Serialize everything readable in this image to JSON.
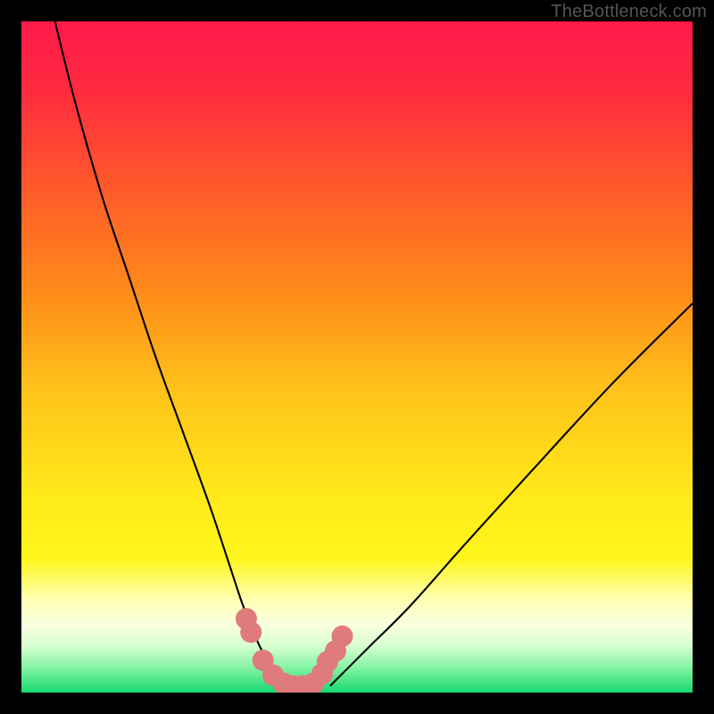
{
  "watermark": "TheBottleneck.com",
  "chart_data": {
    "type": "line",
    "title": "",
    "xlabel": "",
    "ylabel": "",
    "xlim": [
      0,
      100
    ],
    "ylim": [
      0,
      100
    ],
    "background_gradient": {
      "stops": [
        {
          "offset": 0.0,
          "color": "#ff1a4b"
        },
        {
          "offset": 0.1,
          "color": "#ff2a3f"
        },
        {
          "offset": 0.25,
          "color": "#ff5a2a"
        },
        {
          "offset": 0.4,
          "color": "#ff8a1a"
        },
        {
          "offset": 0.55,
          "color": "#ffc21a"
        },
        {
          "offset": 0.7,
          "color": "#ffe81a"
        },
        {
          "offset": 0.8,
          "color": "#fff61a"
        },
        {
          "offset": 0.86,
          "color": "#ffffb0"
        },
        {
          "offset": 0.9,
          "color": "#faffe0"
        },
        {
          "offset": 0.93,
          "color": "#d8ffd0"
        },
        {
          "offset": 0.96,
          "color": "#8cf5a8"
        },
        {
          "offset": 1.0,
          "color": "#17d86f"
        }
      ]
    },
    "series": [
      {
        "name": "curve-left",
        "x": [
          5,
          8,
          12,
          16,
          20,
          24,
          28,
          31,
          33,
          35,
          36.5,
          38,
          39
        ],
        "y": [
          100,
          88,
          74,
          62,
          50,
          39,
          28,
          19,
          13,
          8,
          5,
          2.5,
          1
        ]
      },
      {
        "name": "curve-right",
        "x": [
          46,
          48,
          52,
          58,
          66,
          76,
          88,
          100
        ],
        "y": [
          1,
          3,
          7,
          13,
          22,
          33,
          46,
          58
        ]
      },
      {
        "name": "markers",
        "x": [
          33.5,
          34.2,
          36.0,
          37.5,
          39.0,
          40.5,
          42.0,
          43.5,
          44.8,
          45.6,
          46.8,
          47.8
        ],
        "y": [
          11.0,
          9.0,
          4.8,
          2.6,
          1.4,
          1.0,
          1.0,
          1.4,
          2.8,
          4.6,
          6.2,
          8.4
        ]
      }
    ],
    "marker_color": "#df7b7d",
    "marker_radius": 1.6,
    "curve_color": "#000000",
    "curve_width": 0.28
  }
}
